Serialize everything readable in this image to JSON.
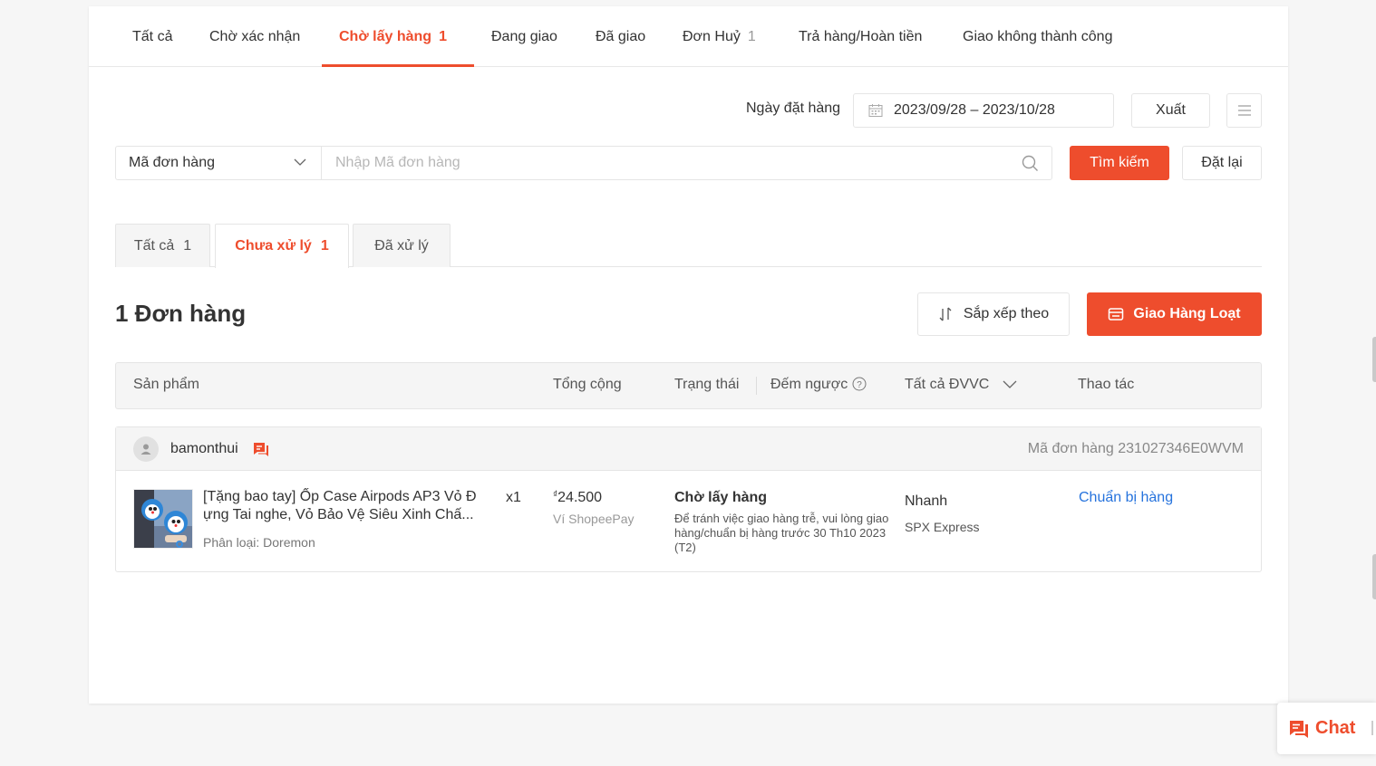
{
  "status_tabs": [
    {
      "label": "Tất cả",
      "count": ""
    },
    {
      "label": "Chờ xác nhận",
      "count": ""
    },
    {
      "label": "Chờ lấy hàng",
      "count": "1"
    },
    {
      "label": "Đang giao",
      "count": ""
    },
    {
      "label": "Đã giao",
      "count": ""
    },
    {
      "label": "Đơn Huỷ",
      "count": "1"
    },
    {
      "label": "Trả hàng/Hoàn tiền",
      "count": ""
    },
    {
      "label": "Giao không thành công",
      "count": ""
    }
  ],
  "filters": {
    "date_label": "Ngày đặt hàng",
    "date_range": "2023/09/28 – 2023/10/28",
    "export_label": "Xuất",
    "search_field": "Mã đơn hàng",
    "search_placeholder": "Nhập Mã đơn hàng",
    "search_button": "Tìm kiếm",
    "reset_button": "Đặt lại"
  },
  "sub_tabs": [
    {
      "label": "Tất cả",
      "count": "1"
    },
    {
      "label": "Chưa xử lý",
      "count": "1"
    },
    {
      "label": "Đã xử lý",
      "count": ""
    }
  ],
  "summary": {
    "order_count": "1 Đơn hàng",
    "sort_label": "Sắp xếp theo",
    "bulk_ship_label": "Giao Hàng Loạt"
  },
  "table_header": {
    "product": "Sản phẩm",
    "total": "Tổng cộng",
    "status": "Trạng thái",
    "countdown": "Đếm ngược",
    "carrier": "Tất cả ĐVVC",
    "actions": "Thao tác"
  },
  "order": {
    "buyer": "bamonthui",
    "order_id": "Mã đơn hàng 231027346E0WVM",
    "product_line1": "[Tặng bao tay] Ốp Case Airpods AP3 Vỏ Đ",
    "product_line2": "ựng Tai nghe, Vỏ Bảo Vệ Siêu Xinh Chấ...",
    "variation": "Phân loại: Doremon",
    "quantity": "x1",
    "currency": "₫",
    "price": "24.500",
    "payment": "Ví ShopeePay",
    "status": "Chờ lấy hàng",
    "status_note": "Để tránh việc giao hàng trễ, vui lòng giao hàng/chuẩn bị hàng trước 30 Th10 2023 (T2)",
    "carrier": "Nhanh",
    "carrier_sub": "SPX Express",
    "action": "Chuẩn bị hàng"
  },
  "chat": {
    "label": "Chat"
  },
  "colors": {
    "accent": "#ee4d2d",
    "link": "#2673dd"
  }
}
